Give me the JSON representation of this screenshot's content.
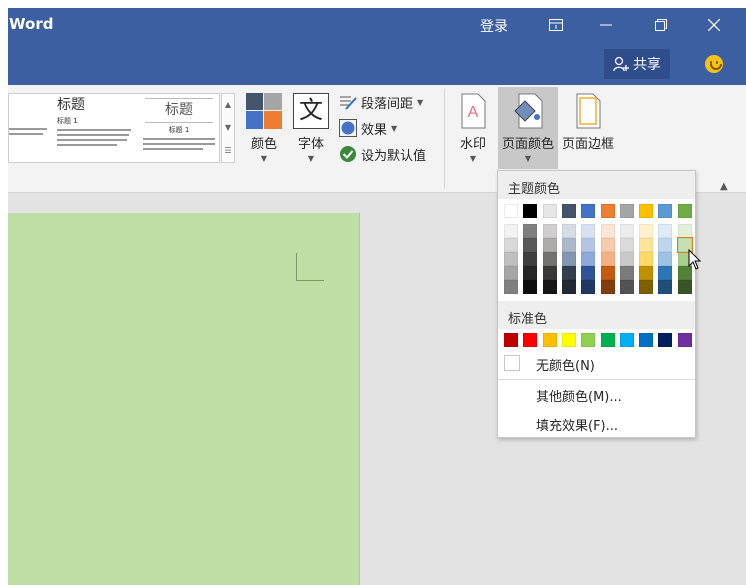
{
  "titlebar": {
    "app_name": "Word",
    "login": "登录"
  },
  "tabs": {
    "share": "共享"
  },
  "ribbon": {
    "style_gallery": [
      {
        "title": "",
        "subtitle": ""
      },
      {
        "title": "标题",
        "subtitle": "标题 1"
      },
      {
        "title": "标题",
        "subtitle": "标题 1"
      }
    ],
    "colors_label": "颜色",
    "fonts_label": "字体",
    "fonts_glyph": "文",
    "paragraph_spacing": "段落间距",
    "effects": "效果",
    "set_default": "设为默认值",
    "watermark": "水印",
    "page_color": "页面颜色",
    "page_borders": "页面边框"
  },
  "dropdown": {
    "theme_header": "主题颜色",
    "standard_header": "标准色",
    "no_color": "无颜色(N)",
    "more_colors": "其他颜色(M)...",
    "fill_effects": "填充效果(F)...",
    "theme_top": [
      "#ffffff",
      "#000000",
      "#e7e6e6",
      "#44546a",
      "#4472c4",
      "#ed7d31",
      "#a5a5a5",
      "#ffc000",
      "#5b9bd5",
      "#70ad47"
    ],
    "theme_shades": [
      [
        "#f2f2f2",
        "#d9d9d9",
        "#bfbfbf",
        "#a6a6a6",
        "#808080"
      ],
      [
        "#7f7f7f",
        "#595959",
        "#404040",
        "#262626",
        "#0d0d0d"
      ],
      [
        "#d0cece",
        "#aeabab",
        "#757171",
        "#3a3838",
        "#171616"
      ],
      [
        "#d6dce4",
        "#adb9ca",
        "#8497b0",
        "#333f4f",
        "#222a35"
      ],
      [
        "#d9e2f3",
        "#b4c6e7",
        "#8eaadb",
        "#2f5496",
        "#1f3864"
      ],
      [
        "#fbe5d5",
        "#f7cbac",
        "#f4b183",
        "#c55a11",
        "#833c0b"
      ],
      [
        "#ededed",
        "#dbdbdb",
        "#c9c9c9",
        "#7b7b7b",
        "#525252"
      ],
      [
        "#fff2cc",
        "#fee599",
        "#ffd965",
        "#bf9000",
        "#7f6000"
      ],
      [
        "#deebf6",
        "#bdd7ee",
        "#9cc3e5",
        "#2e75b5",
        "#1f4e79"
      ],
      [
        "#e2efd9",
        "#c5e0b3",
        "#a8d08d",
        "#538135",
        "#375623"
      ]
    ],
    "standard_colors": [
      "#c00000",
      "#ff0000",
      "#ffc000",
      "#ffff00",
      "#92d050",
      "#00b050",
      "#00b0f0",
      "#0070c0",
      "#002060",
      "#7030a0"
    ]
  },
  "document": {
    "page_color": "#bfdfa5"
  }
}
